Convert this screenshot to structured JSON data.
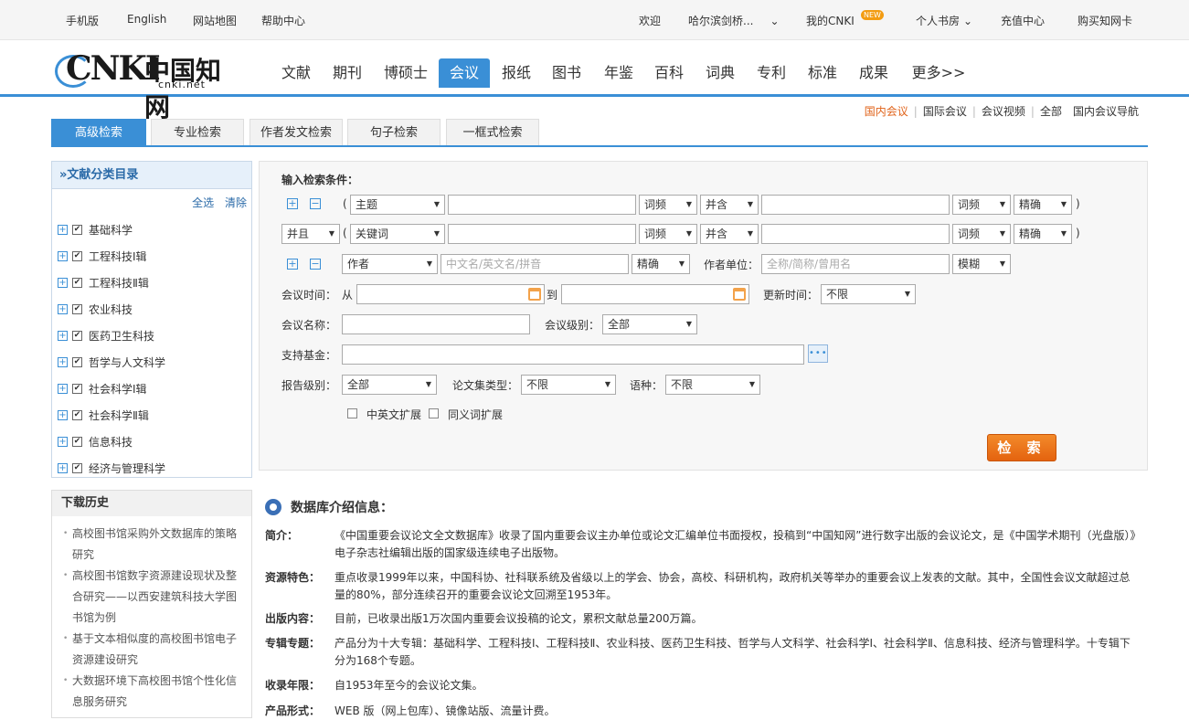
{
  "topbar": {
    "mobile": "手机版",
    "english": "English",
    "sitemap": "网站地图",
    "help": "帮助中心",
    "welcome": "欢迎",
    "org": "哈尔滨剑桥...",
    "my_cnki": "我的CNKI",
    "new_badge": "NEW",
    "bookshelf": "个人书房",
    "recharge": "充值中心",
    "buy_card": "购买知网卡"
  },
  "logo": {
    "cnki": "CNKI",
    "cn": "中国知网",
    "url": "cnki.net"
  },
  "nav": [
    "文献",
    "期刊",
    "博硕士",
    "会议",
    "报纸",
    "图书",
    "年鉴",
    "百科",
    "词典",
    "专利",
    "标准",
    "成果",
    "更多>>"
  ],
  "nav_active": 3,
  "subnav": [
    "国内会议",
    "国际会议",
    "会议视频",
    "全部",
    "国内会议导航"
  ],
  "tabs": [
    "高级检索",
    "专业检索",
    "作者发文检索",
    "句子检索",
    "一框式检索"
  ],
  "catalog": {
    "title": "»文献分类目录",
    "select_all": "全选",
    "clear": "清除",
    "items": [
      "基础科学",
      "工程科技Ⅰ辑",
      "工程科技Ⅱ辑",
      "农业科技",
      "医药卫生科技",
      "哲学与人文科学",
      "社会科学Ⅰ辑",
      "社会科学Ⅱ辑",
      "信息科技",
      "经济与管理科学"
    ]
  },
  "history": {
    "title": "下载历史",
    "items": [
      "高校图书馆采购外文数据库的策略研究",
      "高校图书馆数字资源建设现状及整合研究——以西安建筑科技大学图书馆为例",
      "基于文本相似度的高校图书馆电子资源建设研究",
      "大数据环境下高校图书馆个性化信息服务研究"
    ]
  },
  "search": {
    "input_label": "输入检索条件：",
    "row1": {
      "paren_open": "(",
      "field": "主题",
      "freq1": "词频",
      "logic": "并含",
      "freq2": "词频",
      "match": "精确",
      "paren_close": ")"
    },
    "row2": {
      "op": "并且",
      "paren_open": "(",
      "field": "关键词",
      "freq1": "词频",
      "logic": "并含",
      "freq2": "词频",
      "match": "精确",
      "paren_close": ")"
    },
    "row3": {
      "field": "作者",
      "placeholder": "中文名/英文名/拼音",
      "match": "精确",
      "unit_label": "作者单位：",
      "unit_placeholder": "全称/简称/曾用名",
      "unit_match": "模糊"
    },
    "time": {
      "label": "会议时间：",
      "from": "从",
      "to": "到",
      "update_label": "更新时间：",
      "update_value": "不限"
    },
    "conf_name_label": "会议名称：",
    "level_label": "会议级别：",
    "level_value": "全部",
    "fund_label": "支持基金：",
    "fund_btn": "•••",
    "report_label": "报告级别：",
    "report_value": "全部",
    "collection_label": "论文集类型：",
    "collection_value": "不限",
    "lang_label": "语种：",
    "lang_value": "不限",
    "ext1": "中英文扩展",
    "ext2": "同义词扩展",
    "submit": "检 索"
  },
  "intro": {
    "title": "数据库介绍信息：",
    "rows": [
      {
        "k": "简介：",
        "v": "《中国重要会议论文全文数据库》收录了国内重要会议主办单位或论文汇编单位书面授权，投稿到“中国知网”进行数字出版的会议论文，是《中国学术期刊（光盘版）》电子杂志社编辑出版的国家级连续电子出版物。"
      },
      {
        "k": "资源特色：",
        "v": "重点收录1999年以来，中国科协、社科联系统及省级以上的学会、协会，高校、科研机构，政府机关等举办的重要会议上发表的文献。其中，全国性会议文献超过总量的80%，部分连续召开的重要会议论文回溯至1953年。"
      },
      {
        "k": "出版内容：",
        "v": "目前，已收录出版1万次国内重要会议投稿的论文，累积文献总量200万篇。"
      },
      {
        "k": "专辑专题：",
        "v": "产品分为十大专辑：基础科学、工程科技Ⅰ、工程科技Ⅱ、农业科技、医药卫生科技、哲学与人文科学、社会科学Ⅰ、社会科学Ⅱ、信息科技、经济与管理科学。十专辑下分为168个专题。"
      },
      {
        "k": "收录年限：",
        "v": "自1953年至今的会议论文集。"
      },
      {
        "k": "产品形式：",
        "v": "WEB 版（网上包库）、镜像站版、流量计费。"
      }
    ]
  }
}
